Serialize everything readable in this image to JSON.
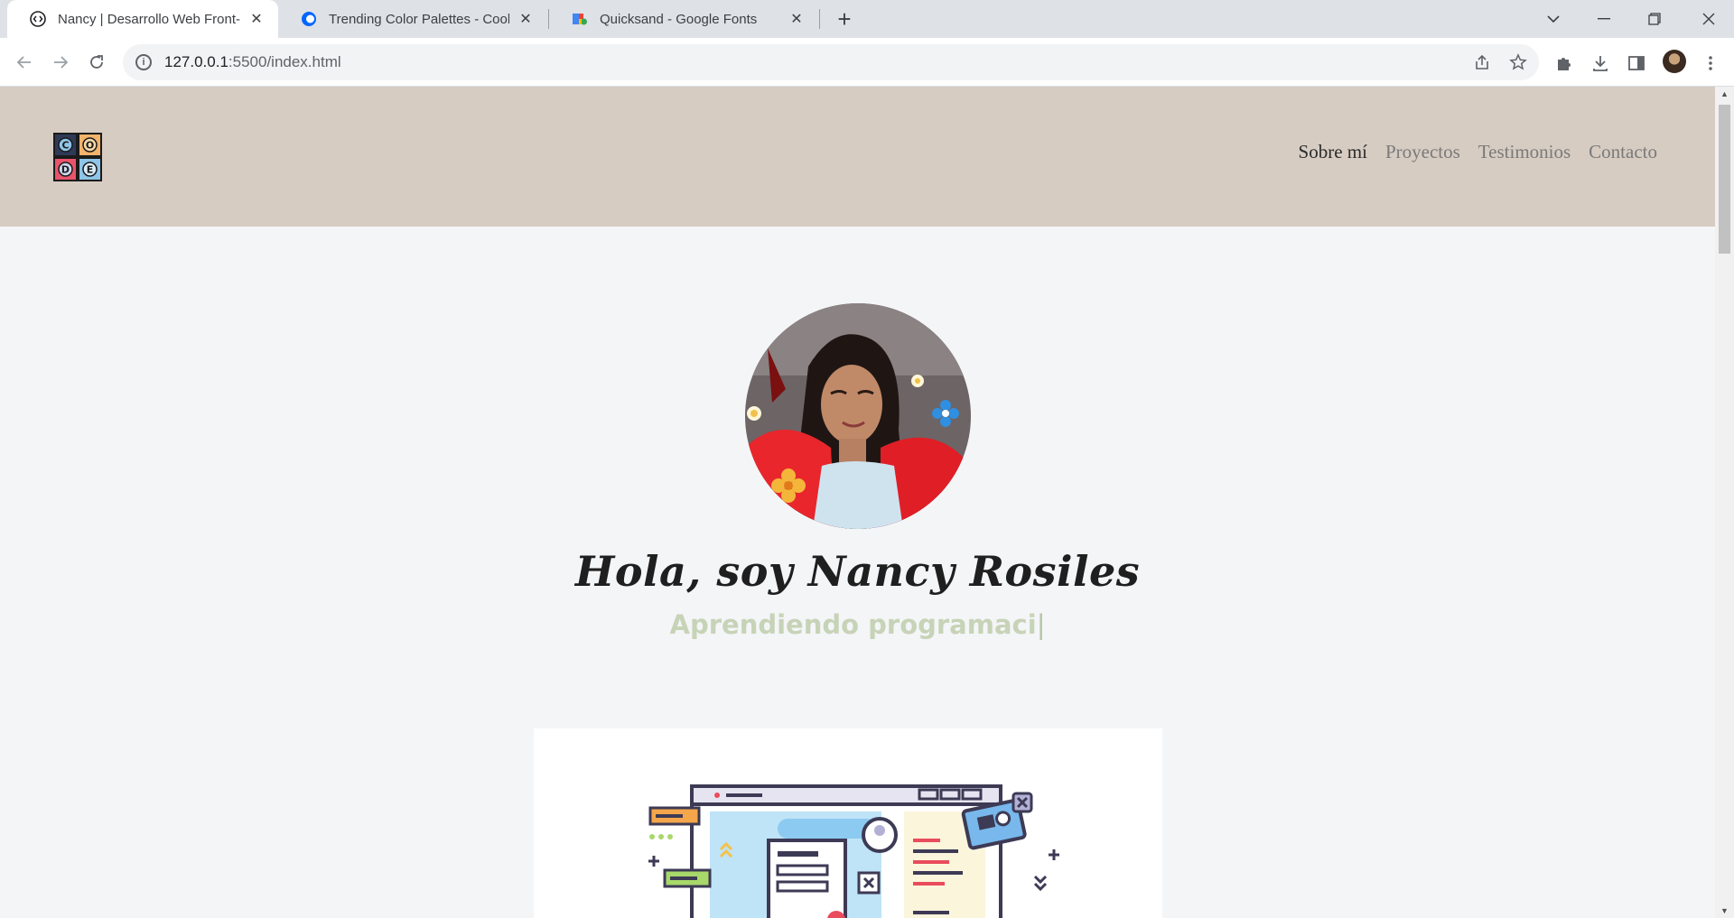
{
  "browser": {
    "tabs": [
      {
        "title": "Nancy | Desarrollo Web Front-End",
        "active": true,
        "favicon": "code-circle-icon"
      },
      {
        "title": "Trending Color Palettes - Coolors",
        "active": false,
        "favicon": "coolors-icon"
      },
      {
        "title": "Quicksand - Google Fonts",
        "active": false,
        "favicon": "google-fonts-icon"
      }
    ],
    "url_host": "127.0.0.1",
    "url_path": ":5500/index.html",
    "icons": {
      "back": "arrow-left-icon",
      "forward": "arrow-right-icon",
      "reload": "reload-icon",
      "share": "share-icon",
      "bookmark": "star-icon",
      "extensions": "puzzle-icon",
      "download": "download-icon",
      "sidepanel": "side-panel-icon",
      "menu": "kebab-menu-icon"
    }
  },
  "site": {
    "logo_letters": [
      "C",
      "O",
      "D",
      "E"
    ],
    "nav": [
      {
        "label": "Sobre mí",
        "current": true
      },
      {
        "label": "Proyectos",
        "current": false
      },
      {
        "label": "Testimonios",
        "current": false
      },
      {
        "label": "Contacto",
        "current": false
      }
    ],
    "hero": {
      "name": "Hola, soy Nancy Rosiles",
      "typing_text": "Aprendiendo programaci",
      "cursor": "|"
    },
    "colors": {
      "header_bg": "#d6ccc2",
      "page_bg": "#f4f5f7",
      "subtitle": "#c7d3b7",
      "nav_active": "#2b2b2b",
      "nav_inactive": "#7a7a7a"
    }
  }
}
